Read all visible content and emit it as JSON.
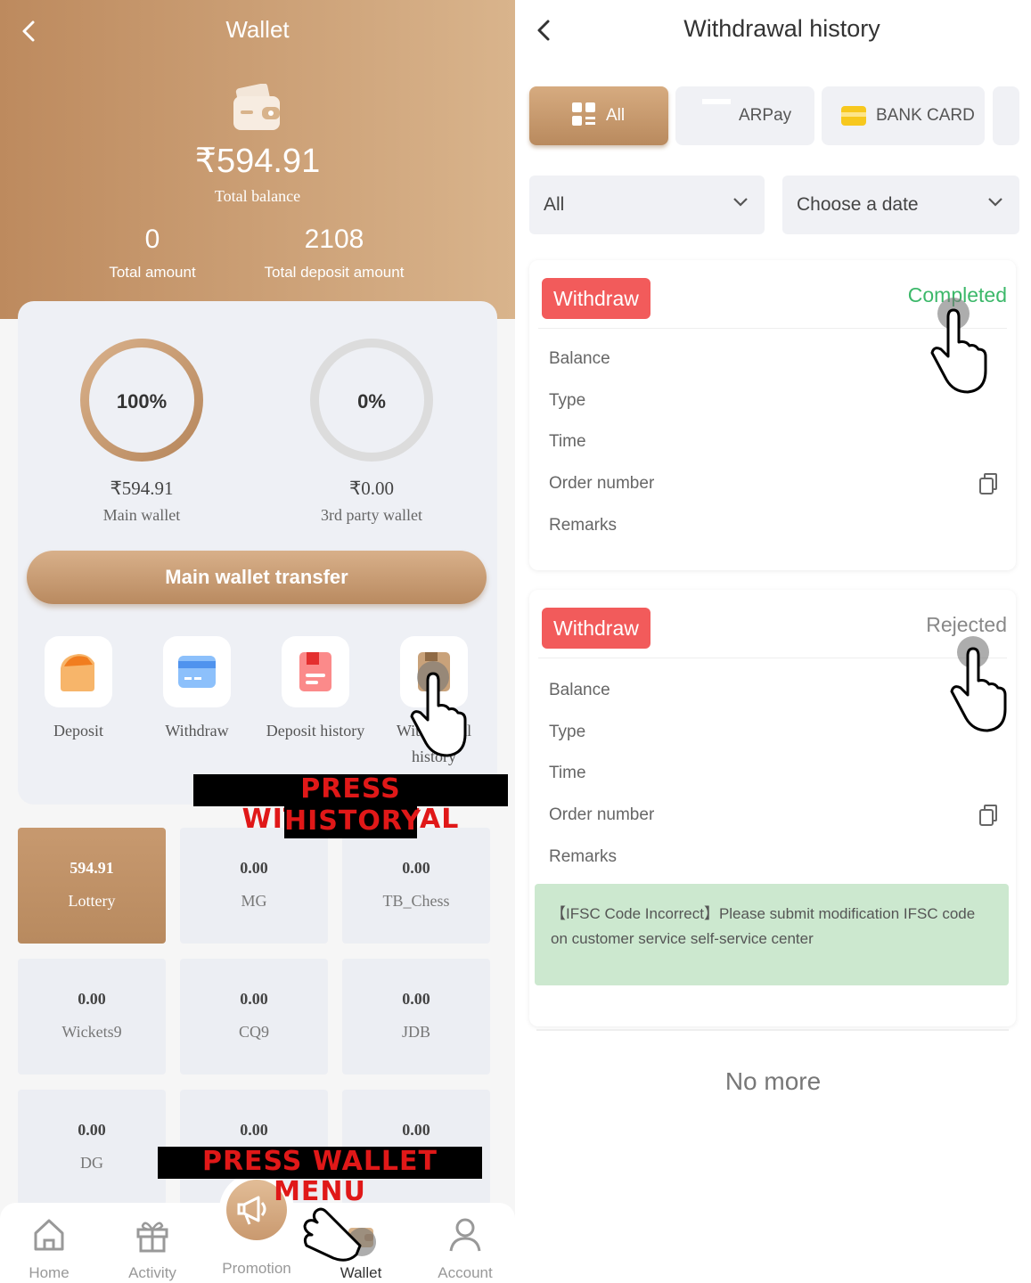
{
  "wallet": {
    "title": "Wallet",
    "total_balance_value": "₹594.91",
    "total_balance_label": "Total balance",
    "total_amount_value": "0",
    "total_amount_label": "Total amount",
    "total_deposit_value": "2108",
    "total_deposit_label": "Total deposit amount",
    "main_wallet": {
      "percent_label": "100%",
      "percent": 100,
      "amount": "₹594.91",
      "label": "Main wallet"
    },
    "third_party_wallet": {
      "percent_label": "0%",
      "percent": 0,
      "amount": "₹0.00",
      "label": "3rd party wallet"
    },
    "transfer_button": "Main wallet transfer",
    "actions": [
      {
        "label": "Deposit",
        "icon": "deposit-icon"
      },
      {
        "label": "Withdraw",
        "icon": "withdraw-icon"
      },
      {
        "label": "Deposit history",
        "icon": "deposit-history-icon"
      },
      {
        "label": "Withdrawal history",
        "icon": "withdrawal-history-icon"
      }
    ],
    "games": [
      {
        "value": "594.91",
        "name": "Lottery"
      },
      {
        "value": "0.00",
        "name": "MG"
      },
      {
        "value": "0.00",
        "name": "TB_Chess"
      },
      {
        "value": "0.00",
        "name": "Wickets9"
      },
      {
        "value": "0.00",
        "name": "CQ9"
      },
      {
        "value": "0.00",
        "name": "JDB"
      },
      {
        "value": "0.00",
        "name": "DG"
      },
      {
        "value": "0.00",
        "name": ""
      },
      {
        "value": "0.00",
        "name": ""
      }
    ],
    "nav": [
      {
        "label": "Home",
        "icon": "home-icon"
      },
      {
        "label": "Activity",
        "icon": "gift-icon"
      },
      {
        "label": "Promotion",
        "icon": "megaphone-icon"
      },
      {
        "label": "Wallet",
        "icon": "wallet-icon"
      },
      {
        "label": "Account",
        "icon": "user-icon"
      }
    ],
    "overlay_1_line1": "PRESS WITHDRAWAL",
    "overlay_1_line2": "HISTORY",
    "overlay_2": "PRESS WALLET MENU",
    "colors": {
      "accent": "#c59a6f",
      "header_start": "#bd8a5e",
      "header_end": "#d9b48c"
    }
  },
  "history": {
    "title": "Withdrawal history",
    "tabs": [
      {
        "label": "All",
        "icon": "grid-icon"
      },
      {
        "label": "ARPay",
        "icon": "arpay-icon"
      },
      {
        "label": "BANK CARD",
        "icon": "bank-card-icon"
      }
    ],
    "filter_type": "All",
    "filter_date": "Choose a date",
    "records": [
      {
        "badge": "Withdraw",
        "status": "Completed",
        "status_color": "#3cb86a",
        "fields": [
          "Balance",
          "Type",
          "Time",
          "Order number",
          "Remarks"
        ]
      },
      {
        "badge": "Withdraw",
        "status": "Rejected",
        "status_color": "#888888",
        "fields": [
          "Balance",
          "Type",
          "Time",
          "Order number",
          "Remarks"
        ],
        "remark_text": "【IFSC Code Incorrect】Please submit modification IFSC code on customer service self-service center"
      }
    ],
    "no_more": "No more"
  }
}
